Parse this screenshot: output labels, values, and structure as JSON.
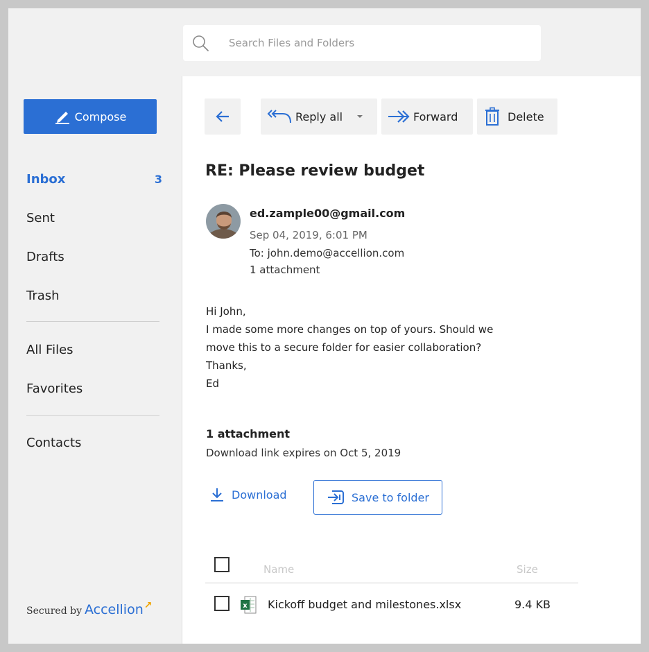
{
  "search": {
    "placeholder": "Search Files and Folders"
  },
  "sidebar": {
    "compose_label": "Compose",
    "items": [
      {
        "label": "Inbox",
        "count": "3"
      },
      {
        "label": "Sent"
      },
      {
        "label": "Drafts"
      },
      {
        "label": "Trash"
      },
      {
        "label": "All Files"
      },
      {
        "label": "Favorites"
      },
      {
        "label": "Contacts"
      }
    ],
    "secured_by": "Secured by",
    "brand": "Accellion"
  },
  "toolbar": {
    "reply_all": "Reply all",
    "forward": "Forward",
    "delete": "Delete"
  },
  "message": {
    "subject": "RE: Please review budget",
    "from": "ed.zample00@gmail.com",
    "date": "Sep 04, 2019, 6:01 PM",
    "to": "To: john.demo@accellion.com",
    "attachment_count": "1 attachment",
    "body": [
      "Hi John,",
      "I made some more changes on top of yours. Should we",
      "move this to a secure folder for easier collaboration?",
      "Thanks,",
      "Ed"
    ]
  },
  "attachments": {
    "title": "1 attachment",
    "expires": "Download link expires on Oct 5, 2019",
    "download_label": "Download",
    "save_label": "Save to folder",
    "columns": {
      "name": "Name",
      "size": "Size"
    },
    "files": [
      {
        "name": "Kickoff budget and milestones.xlsx",
        "size": "9.4 KB",
        "icon": "excel-file-icon"
      }
    ]
  },
  "colors": {
    "accent": "#2b6fd4",
    "panel": "#f1f1f1",
    "brand_mark": "#f0a500",
    "excel": "#1f7244"
  }
}
